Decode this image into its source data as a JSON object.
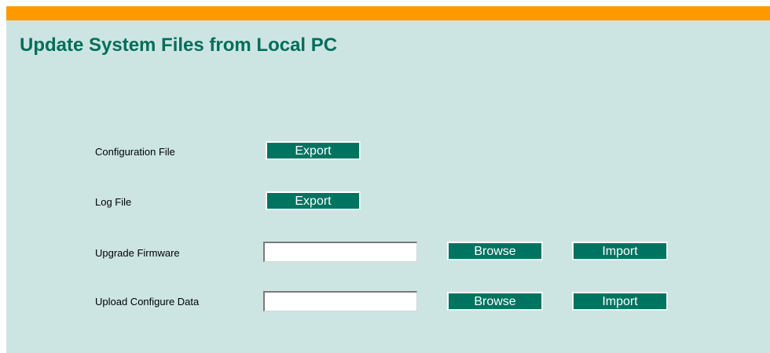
{
  "header": {
    "title": "Update System Files from Local PC"
  },
  "rows": [
    {
      "label": "Configuration File",
      "actions": [
        "Export"
      ]
    },
    {
      "label": "Log File",
      "actions": [
        "Export"
      ]
    },
    {
      "label": "Upgrade Firmware",
      "file_value": "",
      "actions": [
        "Browse",
        "Import"
      ]
    },
    {
      "label": "Upload Configure Data",
      "file_value": "",
      "actions": [
        "Browse",
        "Import"
      ]
    }
  ],
  "colors": {
    "top_bar": "#ff9900",
    "panel_bg": "#cce5e3",
    "title": "#006e5a",
    "button_bg": "#007461",
    "button_text": "#ffffff"
  }
}
